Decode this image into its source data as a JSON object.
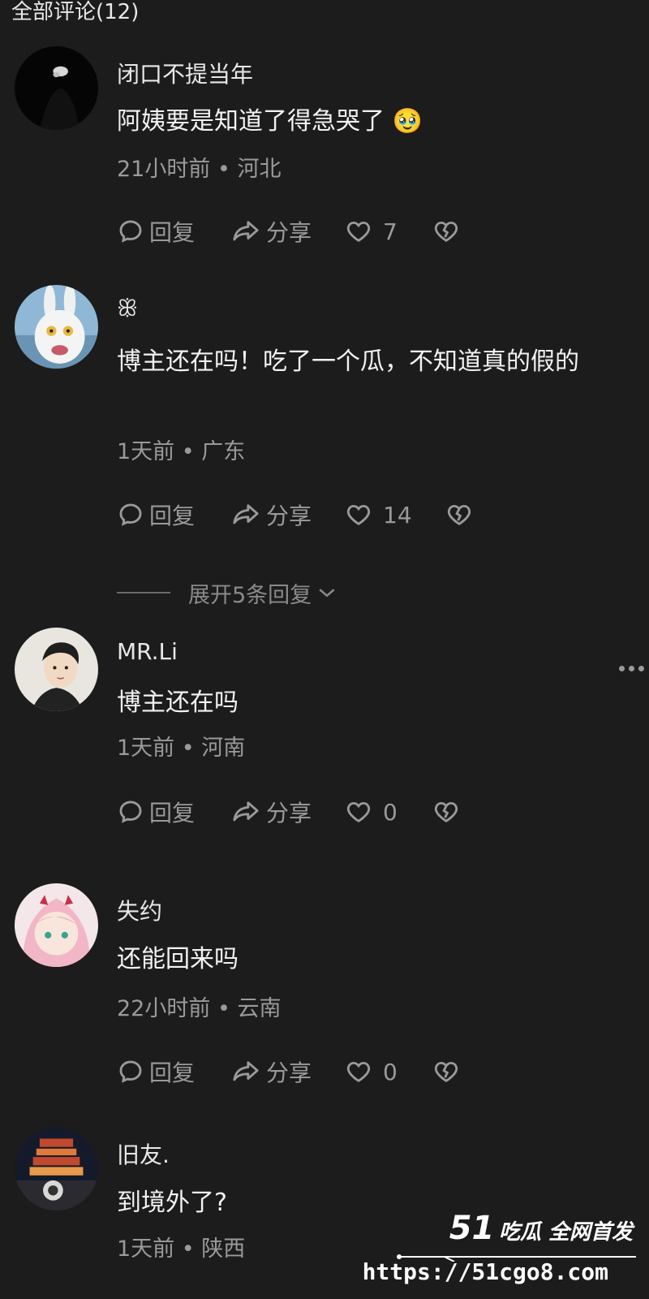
{
  "header": {
    "title": "全部评论(12)"
  },
  "actions": {
    "reply": "回复",
    "share": "分享"
  },
  "comments": [
    {
      "username": "闭口不提当年",
      "text": "阿姨要是知道了得急哭了 🥹",
      "meta": "21小时前 • 河北",
      "likes": "7",
      "avatar_icon": "dark-figure-avatar"
    },
    {
      "username": "ꕥ",
      "text": "博主还在吗！吃了一个瓜，不知道真的假的",
      "meta": "1天前 • 广东",
      "likes": "14",
      "avatar_icon": "rabbid-avatar"
    },
    {
      "username": "MR.Li",
      "text": "博主还在吗",
      "meta": "1天前 • 河南",
      "likes": "0",
      "avatar_icon": "anime-boy-avatar"
    },
    {
      "username": "失约",
      "text": "还能回来吗",
      "meta": "22小时前 • 云南",
      "likes": "0",
      "avatar_icon": "anime-girl-avatar"
    },
    {
      "username": "旧友.",
      "text": "到境外了?",
      "meta": "1天前 • 陕西",
      "avatar_icon": "night-building-avatar"
    }
  ],
  "expand_replies": "展开5条回复",
  "watermark": {
    "logo_number": "51",
    "logo_text": "吃瓜 全网首发",
    "url": "https://51cgo8.com"
  },
  "colors": {
    "background": "#1c1c1c",
    "primary_text": "#e8e8e8",
    "secondary_text": "#9a9a9a"
  }
}
